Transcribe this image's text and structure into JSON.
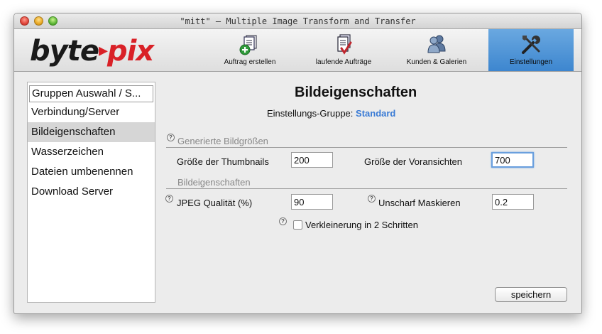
{
  "window": {
    "title": "\"mitt\" – Multiple Image Transform and Transfer"
  },
  "logo": {
    "part1": "byte",
    "part2": "pix"
  },
  "toolbar": {
    "items": [
      {
        "label": "Auftrag erstellen",
        "icon": "document-add-icon"
      },
      {
        "label": "laufende Aufträge",
        "icon": "document-check-icon"
      },
      {
        "label": "Kunden & Galerien",
        "icon": "users-icon"
      },
      {
        "label": "Einstellungen",
        "icon": "tools-icon",
        "active": true
      }
    ]
  },
  "sidebar": {
    "header": "Gruppen Auswahl / S...",
    "items": [
      {
        "label": "Verbindung/Server"
      },
      {
        "label": "Bildeigenschaften",
        "selected": true
      },
      {
        "label": "Wasserzeichen"
      },
      {
        "label": "Dateien umbenennen"
      },
      {
        "label": "Download Server"
      }
    ]
  },
  "main": {
    "title": "Bildeigenschaften",
    "group_label": "Einstellungs-Gruppe:",
    "group_value": "Standard",
    "section1": {
      "title": "Generierte Bildgrößen",
      "thumbnail_label": "Größe der Thumbnails",
      "thumbnail_value": "200",
      "preview_label": "Größe der Voransichten",
      "preview_value": "700"
    },
    "section2": {
      "title": "Bildeigenschaften",
      "jpeg_label": "JPEG Qualität (%)",
      "jpeg_value": "90",
      "unsharp_label": "Unscharf Maskieren",
      "unsharp_value": "0.2",
      "two_step_label": "Verkleinerung in 2 Schritten",
      "two_step_checked": false
    },
    "save_label": "speichern"
  },
  "colors": {
    "accent": "#3d86cf",
    "logo_red": "#d92127",
    "link_blue": "#3a7bd5"
  }
}
